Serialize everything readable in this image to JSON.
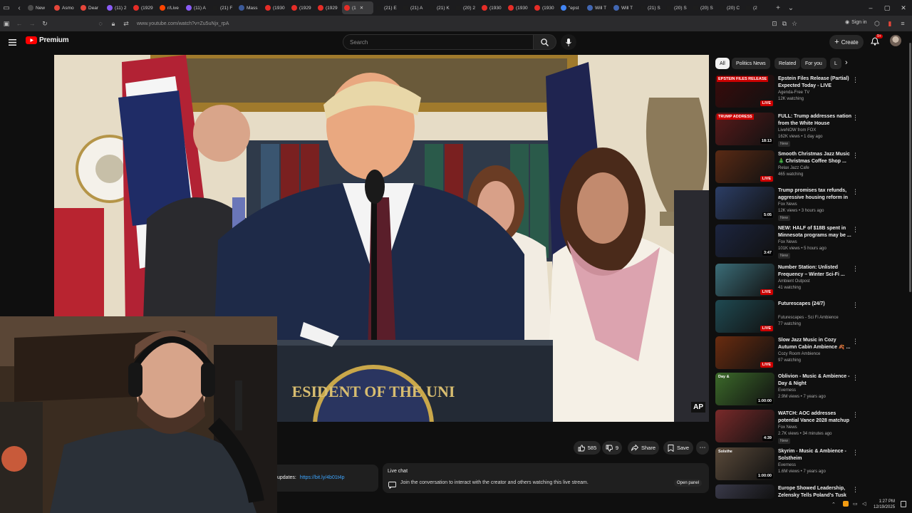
{
  "browser": {
    "tabs": [
      {
        "label": "New",
        "color": "#4a4a4a"
      },
      {
        "label": "Asmo",
        "color": "#e5463a"
      },
      {
        "label": "Dear",
        "color": "#e5463a"
      },
      {
        "label": "(11) 2",
        "color": "#8a5cf6"
      },
      {
        "label": "(1929",
        "color": "#e52d27"
      },
      {
        "label": "r/Live",
        "color": "#ff4500"
      },
      {
        "label": "(11) A",
        "color": "#8a5cf6"
      },
      {
        "label": "(21) F",
        "color": "#1d1d1d"
      },
      {
        "label": "Mass",
        "color": "#3b5998"
      },
      {
        "label": "(1930",
        "color": "#e52d27"
      },
      {
        "label": "(1929",
        "color": "#e52d27"
      },
      {
        "label": "(1929",
        "color": "#e52d27"
      },
      {
        "label": "(1",
        "color": "#e52d27",
        "active": true
      },
      {
        "label": "(21) E",
        "color": "#1d1d1d"
      },
      {
        "label": "(21) A",
        "color": "#1d1d1d"
      },
      {
        "label": "(21) K",
        "color": "#1d1d1d"
      },
      {
        "label": "(20) 2",
        "color": "#1d1d1d"
      },
      {
        "label": "(1930",
        "color": "#e52d27"
      },
      {
        "label": "(1930",
        "color": "#e52d27"
      },
      {
        "label": "(1930",
        "color": "#e52d27"
      },
      {
        "label": "\"epst",
        "color": "#4285f4"
      },
      {
        "label": "Will T",
        "color": "#4267b2"
      },
      {
        "label": "Will T",
        "color": "#4267b2"
      },
      {
        "label": "(21) S",
        "color": "#1d1d1d"
      },
      {
        "label": "(20) S",
        "color": "#1d1d1d"
      },
      {
        "label": "(20) S",
        "color": "#1d1d1d"
      },
      {
        "label": "(20) C",
        "color": "#1d1d1d"
      },
      {
        "label": "(2",
        "color": "#1d1d1d"
      }
    ],
    "url": "www.youtube.com/watch?v=Zu5uNjx_rpA",
    "sign_in": "Sign in"
  },
  "youtube": {
    "logo_text": "Premium",
    "search_placeholder": "Search",
    "create_label": "Create",
    "notif_count": "9+",
    "accent": "#ff0000"
  },
  "video": {
    "watermark": "AP",
    "seal_text": "ESIDENT OF THE UNI"
  },
  "actions": {
    "likes": "585",
    "dislikes": "9",
    "share": "Share",
    "save": "Save"
  },
  "description": {
    "prefix": "updates:",
    "link": "https://bit.ly/4b01t4p"
  },
  "live_chat": {
    "title": "Live chat",
    "message": "Join the conversation to interact with the creator and others watching this live stream.",
    "open_panel": "Open panel"
  },
  "chips": [
    "All",
    "Politics News",
    "Related",
    "For you",
    "L"
  ],
  "recommendations": [
    {
      "title": "Epstein Files Release (Partial) Expected Today - LIVE Breakin...",
      "channel": "Agenda-Free TV",
      "meta": "12K watching",
      "badge": "LIVE",
      "new": false,
      "overlay": "EPSTEIN FILES RELEASE",
      "thumb": "#3a0b0b"
    },
    {
      "title": "FULL: Trump addresses nation from the White House",
      "channel": "LiveNOW from FOX",
      "meta": "162K views • 1 day ago",
      "badge": "18:13",
      "new": true,
      "overlay": "TRUMP ADDRESS",
      "thumb": "#5a1a1a"
    },
    {
      "title": "Smooth Christmas Jazz Music 🎄 Christmas Coffee Shop ...",
      "channel": "Relax Jazz Cafe",
      "meta": "465 watching",
      "badge": "LIVE",
      "new": false,
      "overlay": "",
      "thumb": "#5a2a14"
    },
    {
      "title": "Trump promises tax refunds, aggressive housing reform in ...",
      "channel": "Fox News",
      "meta": "12K views • 3 hours ago",
      "badge": "5:05",
      "new": true,
      "overlay": "",
      "thumb": "#2c3e66"
    },
    {
      "title": "NEW: HALF of $18B spent in Minnesota programs may be ...",
      "channel": "Fox News",
      "meta": "101K views • 5 hours ago",
      "badge": "3:47",
      "new": true,
      "overlay": "",
      "thumb": "#1c2540"
    },
    {
      "title": "Number Station: Unlisted Frequency – Winter Sci-Fi ...",
      "channel": "Ambient Outpost",
      "meta": "41 watching",
      "badge": "LIVE",
      "new": false,
      "overlay": "",
      "thumb": "#3b6d78"
    },
    {
      "title": "Futurescapes (24/7)",
      "channel": "Futurescapes - Sci Fi Ambience",
      "meta": "77 watching",
      "badge": "LIVE",
      "new": false,
      "overlay": "",
      "thumb": "#1f4a52"
    },
    {
      "title": "Slow Jazz Music in Cozy Autumn Cabin Ambience 🍂 ...",
      "channel": "Cozy Room Ambience",
      "meta": "97 watching",
      "badge": "LIVE",
      "new": false,
      "overlay": "",
      "thumb": "#6a2c10"
    },
    {
      "title": "Oblivion - Music & Ambience - Day & Night",
      "channel": "Everness",
      "meta": "2.9M views • 7 years ago",
      "badge": "1:00:00",
      "new": false,
      "overlay": "Day &",
      "thumb": "#3c6a2a"
    },
    {
      "title": "WATCH: AOC addresses potential Vance 2028 matchup",
      "channel": "Fox News",
      "meta": "2.7K views • 34 minutes ago",
      "badge": "4:39",
      "new": true,
      "overlay": "",
      "thumb": "#7a2a2a"
    },
    {
      "title": "Skyrim - Music & Ambience - Solstheim",
      "channel": "Everness",
      "meta": "1.6M views • 7 years ago",
      "badge": "1:00:00",
      "new": false,
      "overlay": "Solsthe",
      "thumb": "#5a4a3a"
    },
    {
      "title": "Europe Showed Leadership, Zelensky Tells Poland's Tusk",
      "channel": "",
      "meta": "",
      "badge": "",
      "new": false,
      "overlay": "",
      "thumb": "#3a3a4a"
    }
  ],
  "taskbar": {
    "time": "1:27 PM",
    "date": "12/19/2025"
  }
}
